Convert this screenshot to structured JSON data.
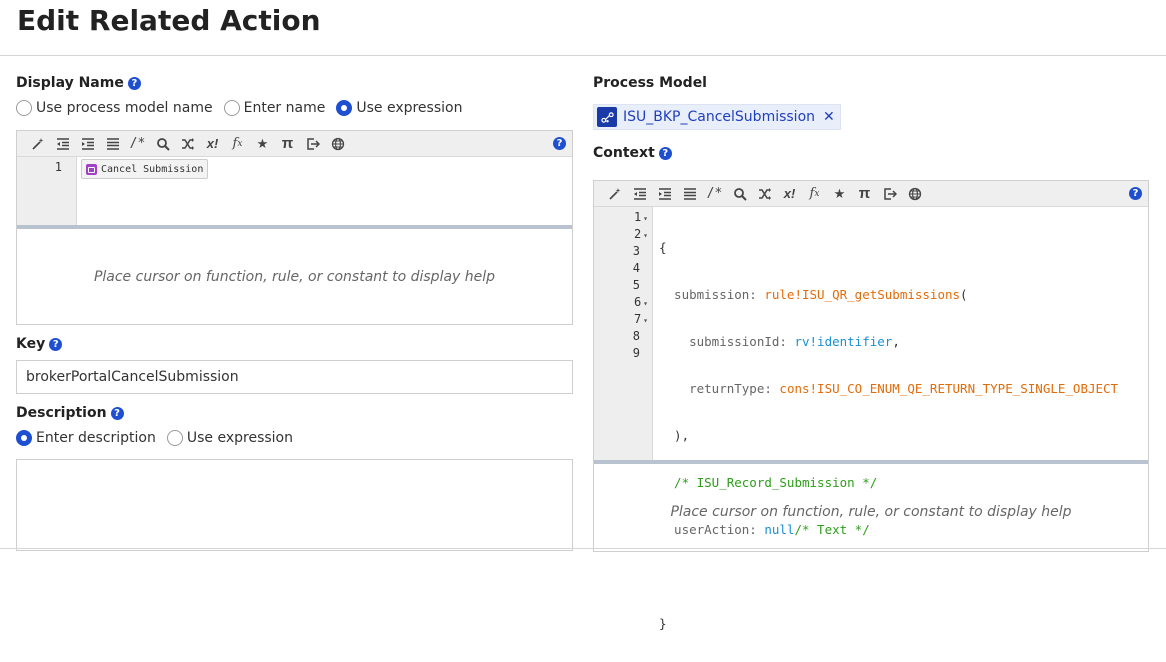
{
  "page": {
    "title": "Edit Related Action"
  },
  "display_name": {
    "label": "Display Name",
    "help": "?",
    "options": [
      {
        "label": "Use process model name",
        "checked": false
      },
      {
        "label": "Enter name",
        "checked": false
      },
      {
        "label": "Use expression",
        "checked": true
      }
    ],
    "editor": {
      "line_numbers": [
        "1"
      ],
      "chip_text": "Cancel Submission",
      "help_text": "Place cursor on function, rule, or constant to display help"
    }
  },
  "key": {
    "label": "Key",
    "help": "?",
    "value": "brokerPortalCancelSubmission"
  },
  "description": {
    "label": "Description",
    "help": "?",
    "options": [
      {
        "label": "Enter description",
        "checked": true
      },
      {
        "label": "Use expression",
        "checked": false
      }
    ],
    "value": ""
  },
  "process_model": {
    "label": "Process Model",
    "name": "ISU_BKP_CancelSubmission",
    "remove_glyph": "✕"
  },
  "context": {
    "label": "Context",
    "help": "?",
    "editor": {
      "line_numbers": [
        "1",
        "2",
        "3",
        "4",
        "5",
        "6",
        "7",
        "8",
        "9"
      ],
      "folds": [
        "▾",
        "▾",
        "",
        "",
        "",
        "▾",
        "▾",
        "",
        ""
      ],
      "lines": [
        "{",
        "  submission: rule!ISU_QR_getSubmissions(",
        "    submissionId: rv!identifier,",
        "    returnType: cons!ISU_CO_ENUM_QE_RETURN_TYPE_SINGLE_OBJECT",
        "  ),",
        "  /* ISU_Record_Submission */",
        "  userAction: null/* Text */",
        "",
        "}"
      ],
      "help_text": "Place cursor on function, rule, or constant to display help"
    }
  },
  "toolbar": {
    "buttons": [
      {
        "name": "magic-wand-icon",
        "glyph": "✎"
      },
      {
        "name": "outdent-icon",
        "glyph": "⇤"
      },
      {
        "name": "indent-icon",
        "glyph": "⇥"
      },
      {
        "name": "format-icon",
        "glyph": "≣"
      },
      {
        "name": "comment-icon",
        "glyph": "/*"
      },
      {
        "name": "search-icon",
        "glyph": "🔍"
      },
      {
        "name": "shuffle-icon",
        "glyph": "⤮"
      },
      {
        "name": "variable-icon",
        "glyph": "x!"
      },
      {
        "name": "function-icon",
        "glyph": "f𝑥"
      },
      {
        "name": "star-icon",
        "glyph": "★"
      },
      {
        "name": "constant-pi-icon",
        "glyph": "π"
      },
      {
        "name": "export-icon",
        "glyph": "⇨"
      },
      {
        "name": "globe-icon",
        "glyph": "⊕"
      }
    ],
    "help": "?"
  },
  "colors": {
    "accent": "#1f4fd1",
    "keyword": "#666666",
    "rule": "#e36c0a",
    "rv": "#1a8fd6",
    "comment": "#2d9e1a"
  }
}
